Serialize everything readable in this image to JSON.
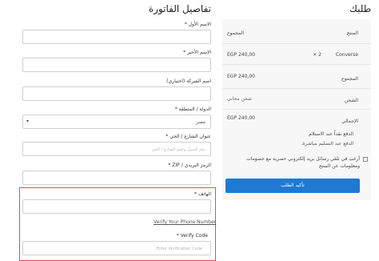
{
  "order": {
    "title": "طلبك",
    "product_header": "المنتج",
    "subtotal_header": "المجموع",
    "item_name": "Converse",
    "item_qty": "× 2",
    "item_price": "EGP 240,00",
    "subtotal_label": "المجموع",
    "subtotal_value": "EGP 240,00",
    "shipping_label": "الشحن",
    "shipping_value": "شحن مجاني",
    "total_label": "الإجمالي",
    "total_value": "EGP 240,00",
    "payment_method": "الدفع نقداً عند الاستلام",
    "payment_desc": "الدفع عند التسليم مباشرة.",
    "newsletter_label": "أرغب في تلقي رسائل بريد إلكتروني حصرية مع خصومات ومعلومات عن المنتج",
    "place_order": "تأكيد الطلب"
  },
  "billing": {
    "title": "تفاصيل الفاتورة",
    "first_name_label": "الاسم الأول *",
    "last_name_label": "الاسم الأخير *",
    "company_label": "اسم الشركة (اختياري)",
    "country_label": "الدولة / المنطقة *",
    "country_value": "مصر",
    "street_label": "عنوان الشارع / الحي *",
    "street_placeholder": "رقم المنزل واسم الشارع / الحي",
    "zip_label": "الرمز البريدي / ZIP *",
    "phone_label": "الهاتف *",
    "verify_link": "Verify Your Phone Number",
    "verify_code_label": "Verify Code *",
    "verify_code_placeholder": "Enter Verification Code"
  },
  "colors": {
    "accent": "#1f79d1",
    "highlight": "#d9534f"
  }
}
